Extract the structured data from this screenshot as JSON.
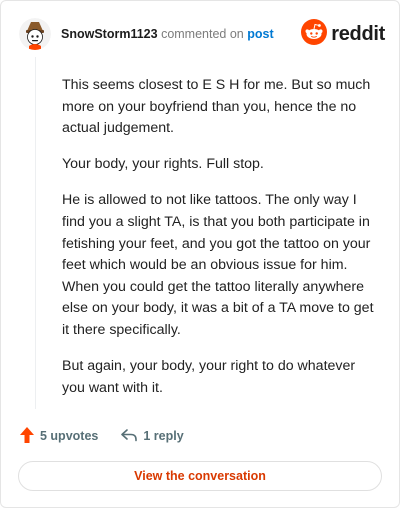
{
  "comment": {
    "username": "SnowStorm1123",
    "action_text": "commented on",
    "post_link": "post",
    "paragraphs": [
      "This seems closest to E S H for me. But so much more on your boyfriend than you, hence the no actual judgement.",
      "Your body, your rights. Full stop.",
      "He is allowed to not like tattoos. The only way I find you a slight TA, is that you both participate in fetishing your feet, and you got the tattoo on your feet which would be an obvious issue for him. When you could get the tattoo literally anywhere else on your body, it was a bit of a TA move to get it there specifically.",
      "But again, your body, your right to do whatever you want with it."
    ],
    "upvotes_label": "5 upvotes",
    "replies_label": "1 reply"
  },
  "brand": {
    "wordmark": "reddit",
    "accent_color": "#ff4500"
  },
  "footer": {
    "view_label": "View the conversation"
  },
  "icons": [
    "user-avatar-icon",
    "reddit-logo-icon",
    "upvote-arrow-icon",
    "reply-arrow-icon"
  ]
}
